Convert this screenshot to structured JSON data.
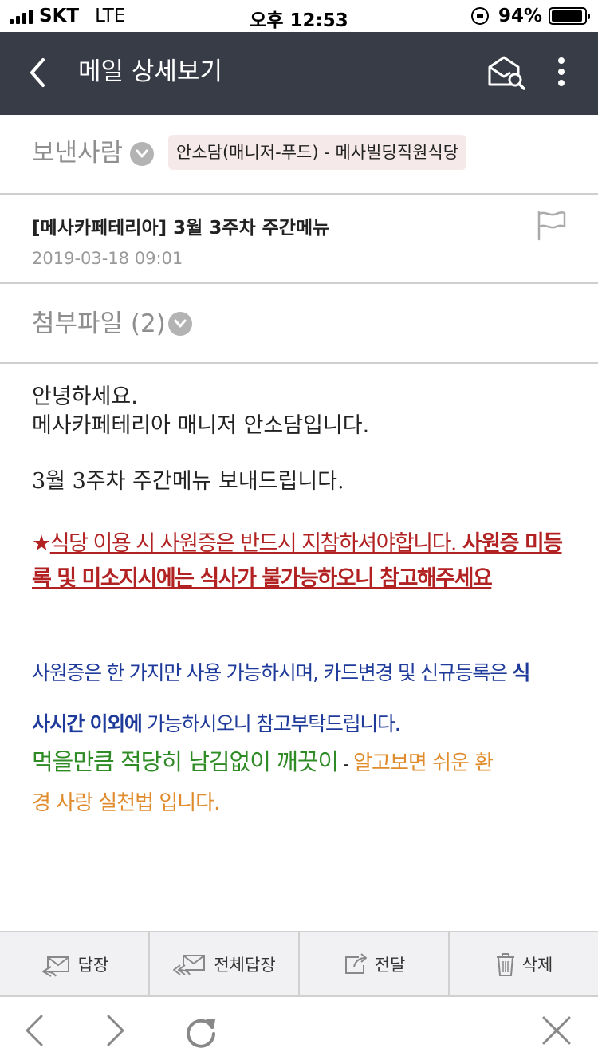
{
  "status_bar": {
    "carrier": "SKT",
    "network": "LTE",
    "time": "오후 12:53",
    "battery_percent": "94%",
    "battery_level": 0.94
  },
  "header": {
    "title": "메일 상세보기"
  },
  "sender": {
    "label": "보낸사람",
    "name": "안소담(매니저-푸드) - 메사빌딩직원식당"
  },
  "mail": {
    "subject": "[메사카페테리아] 3월 3주차 주간메뉴",
    "date": "2019-03-18 09:01"
  },
  "attachments": {
    "label": "첨부파일 (2)"
  },
  "body": {
    "greeting": "안녕하세요.",
    "intro": "메사카페테리아 매니저 안소담입니다.",
    "menu_line": "3월 3주차 주간메뉴 보내드립니다.",
    "warning_star": "★",
    "warning_normal": "식당 이용 시 사원증은 반드시 지참하셔야합니다.",
    "warning_bold_1": " 사원증 미등",
    "warning_bold_2": "록 및 미소지시에는 식사가 불가능하오니 참고해주세요",
    "card_line_1": "사원증은 한 가지만 사용 가능하시며, 카드변경 및 신규등록은 ",
    "card_line_1_bold": "식",
    "card_line_2_bold": "사시간 이외에",
    "card_line_2": " 가능하시오니 참고부탁드립니다.",
    "eco_green": "먹을만큼 적당히 남김없이 깨끗이",
    "eco_dash": " - ",
    "eco_orange_1": "알고보면 쉬운 환",
    "eco_orange_2": "경 사랑 실천법 입니다."
  },
  "actions": {
    "reply": "답장",
    "reply_all": "전체답장",
    "forward": "전달",
    "delete": "삭제"
  },
  "colors": {
    "header_bg": "#373c46",
    "sender_chip_bg": "#f6e9e9",
    "warning": "#b22222",
    "blue_text": "#1e3a9a",
    "green_text": "#2e8b25",
    "orange_text": "#e08b2c"
  },
  "icons": [
    "back-arrow-icon",
    "mail-search-icon",
    "more-vertical-icon",
    "chevron-down-icon",
    "flag-icon",
    "reply-icon",
    "reply-all-icon",
    "forward-icon",
    "trash-icon",
    "nav-back-icon",
    "nav-forward-icon",
    "reload-icon",
    "close-icon"
  ]
}
